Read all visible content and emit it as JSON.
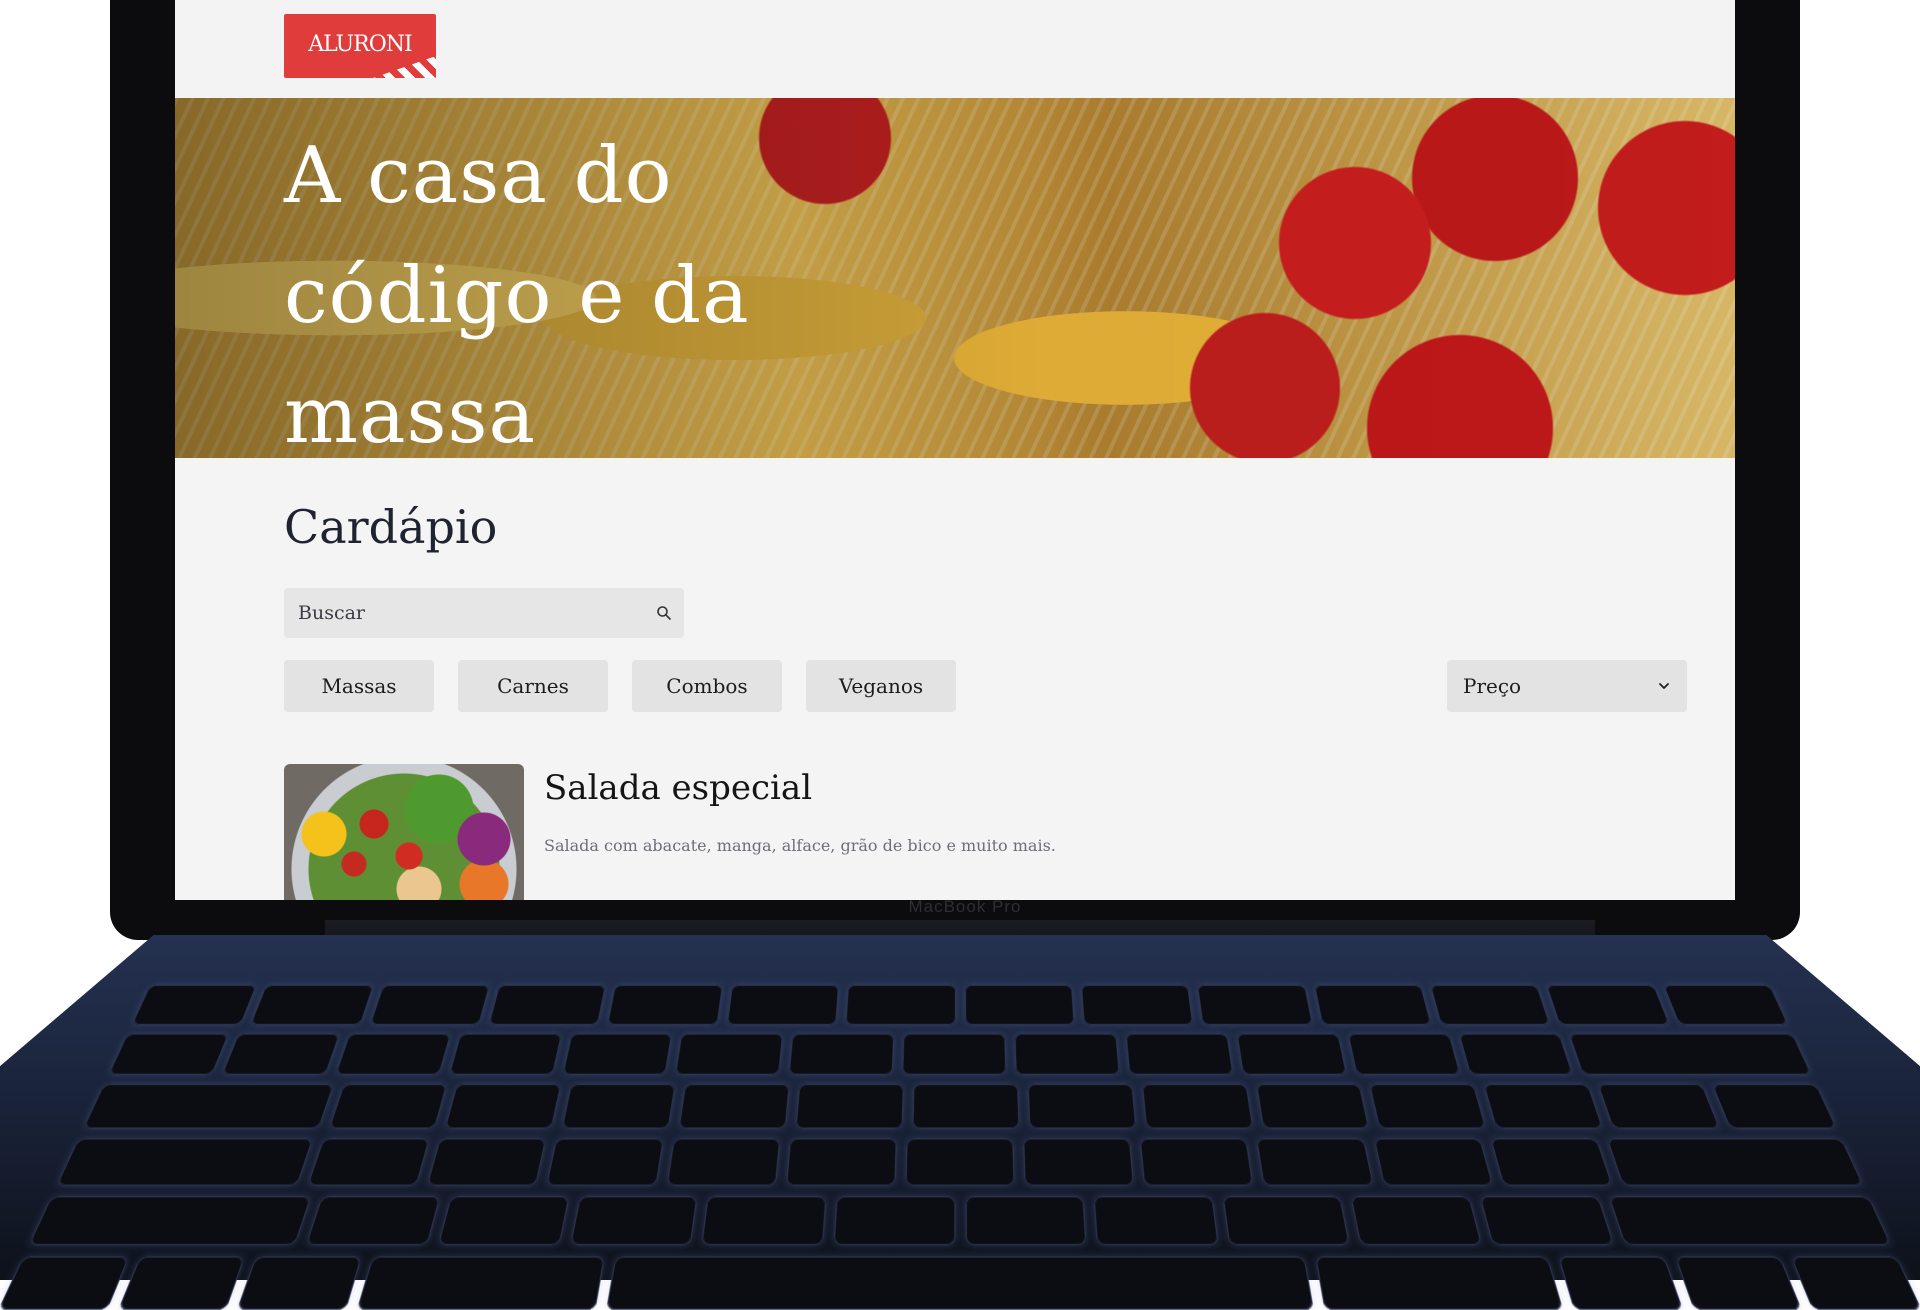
{
  "brand": {
    "logo_text": "ALURONI",
    "color": "#e03c3c"
  },
  "hero": {
    "title": "A casa do código e da massa"
  },
  "menu": {
    "title": "Cardápio",
    "search": {
      "placeholder": "Buscar",
      "icon": "search-icon"
    },
    "filters": [
      "Massas",
      "Carnes",
      "Combos",
      "Veganos"
    ],
    "order": {
      "label": "Preço",
      "icon": "chevron-down-icon"
    },
    "items": [
      {
        "name": "Salada especial",
        "description": "Salada com abacate, manga, alface, grão de bico e muito mais."
      }
    ]
  },
  "device": {
    "bezel_label": "MacBook Pro"
  }
}
